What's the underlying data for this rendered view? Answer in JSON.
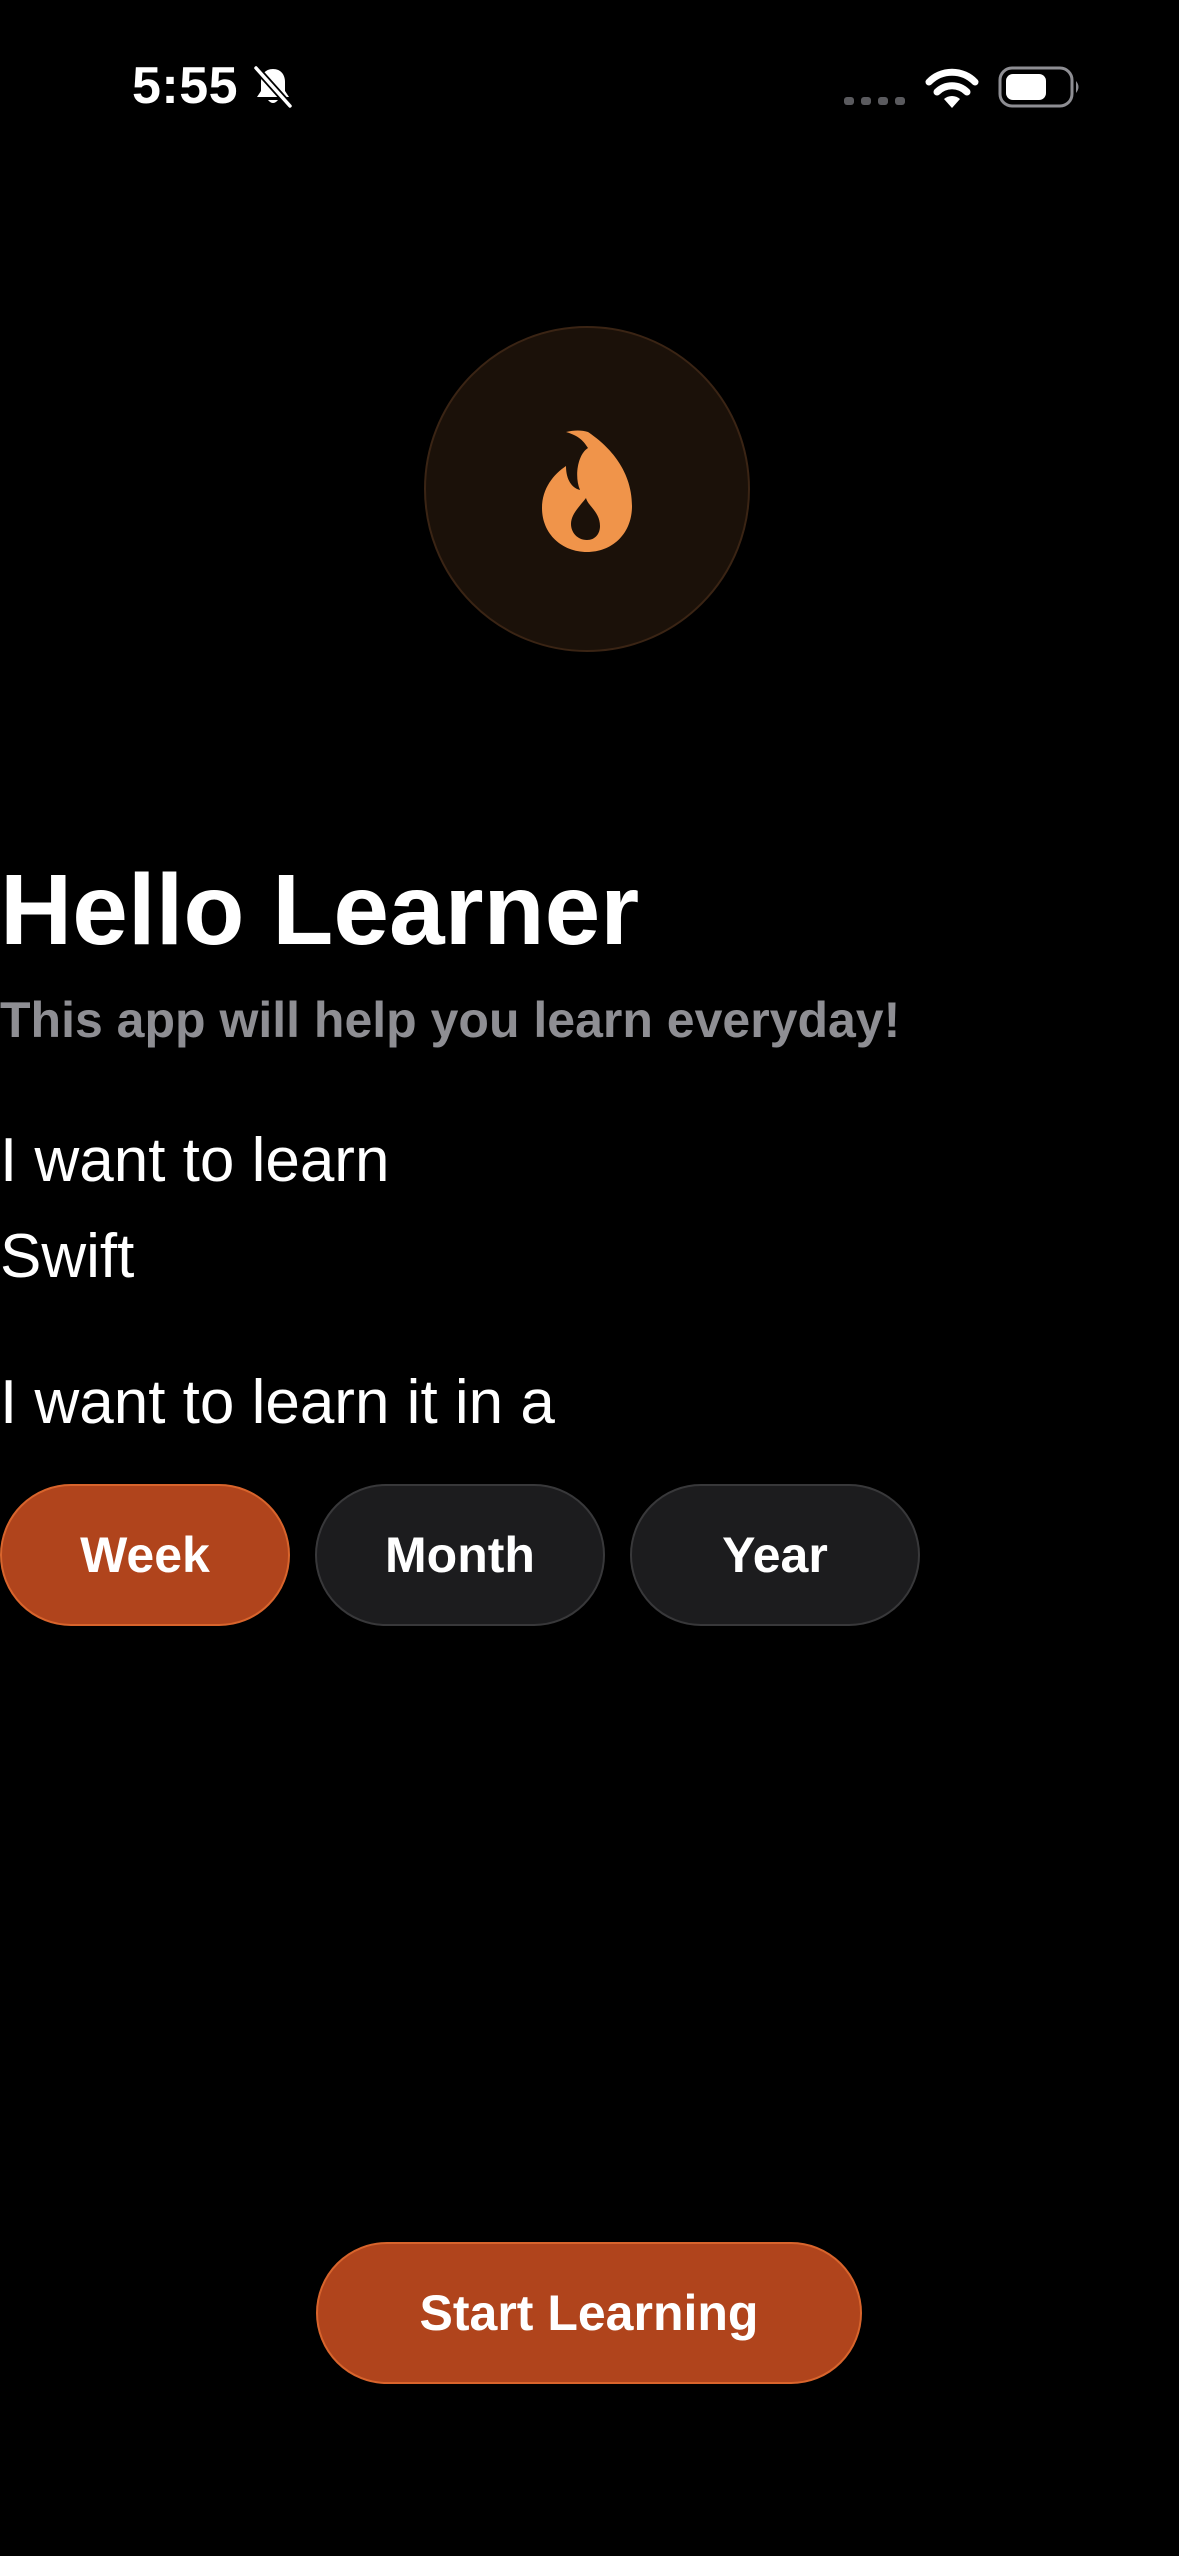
{
  "status_bar": {
    "time": "5:55",
    "icons": [
      "bell-slash-icon",
      "cellular-signal-icon",
      "wifi-icon",
      "battery-icon"
    ]
  },
  "hero": {
    "icon": "flame-icon",
    "accent_color": "#f0944a",
    "circle_color": "#1b1109"
  },
  "header": {
    "title": "Hello Learner",
    "subtitle": "This app will help you learn everyday!"
  },
  "form": {
    "learn_label": "I want to learn",
    "subject_value": "Swift",
    "duration_label": "I want to learn it in a",
    "durations": [
      {
        "label": "Week",
        "selected": true
      },
      {
        "label": "Month",
        "selected": false
      },
      {
        "label": "Year",
        "selected": false
      }
    ]
  },
  "actions": {
    "start_label": "Start Learning",
    "accent_color": "#b0441c"
  }
}
